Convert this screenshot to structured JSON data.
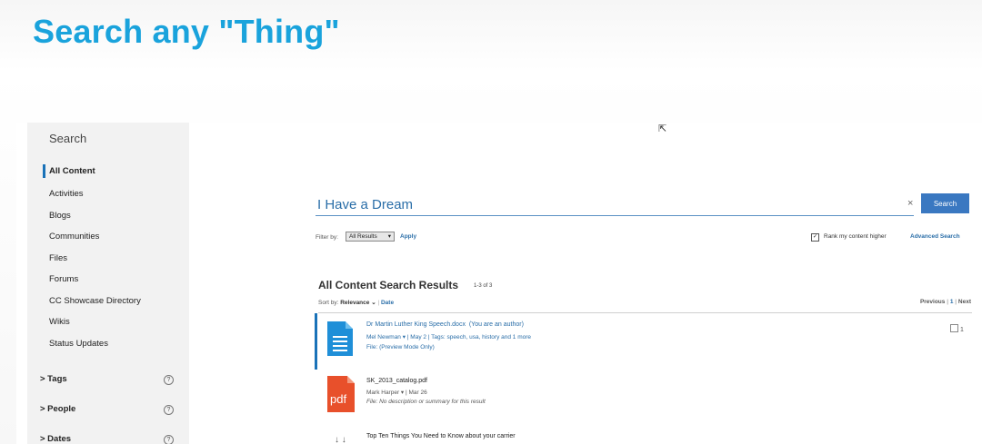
{
  "slide_title": "Search any \"Thing\"",
  "sidebar": {
    "title": "Search",
    "items": [
      {
        "label": "All Content",
        "active": true
      },
      {
        "label": "Activities"
      },
      {
        "label": "Blogs"
      },
      {
        "label": "Communities"
      },
      {
        "label": "Files"
      },
      {
        "label": "Forums"
      },
      {
        "label": "CC Showcase Directory"
      },
      {
        "label": "Wikis"
      },
      {
        "label": "Status Updates"
      }
    ],
    "sections": [
      {
        "label": "> Tags",
        "help": "?"
      },
      {
        "label": "> People",
        "help": "?"
      },
      {
        "label": "> Dates",
        "help": "?"
      }
    ]
  },
  "search": {
    "query": "I Have a Dream",
    "clear": "×",
    "button": "Search"
  },
  "filter": {
    "label": "Filter by:",
    "selected": "All Results",
    "apply": "Apply",
    "rank_label": "Rank my content higher",
    "rank_checked": true,
    "advanced": "Advanced Search"
  },
  "results": {
    "title": "All Content Search Results",
    "count": "1-3 of 3",
    "sort_label": "Sort by:",
    "sort_relevance": "Relevance",
    "sort_date": "Date",
    "pager": {
      "previous": "Previous",
      "current": "1",
      "next": "Next"
    },
    "items": [
      {
        "title": "Dr Martin Luther King Speech.docx",
        "note": "(You are an author)",
        "meta": "Mel Newman  ▾  |  May 2  |  Tags:  speech,  usa,  history  and 1 more",
        "desc": "File:  (Preview Mode Only)",
        "comments": "1",
        "icon": "docx-file-icon"
      },
      {
        "title": "SK_2013_catalog.pdf",
        "meta": "Mark Harper  ▾  |  Mar 26",
        "desc": "File:  No description or summary for this result",
        "icon_text": "pdf",
        "icon": "pdf-file-icon"
      },
      {
        "title": "Top Ten Things You Need to Know about your carrier",
        "icon": "download-icon"
      }
    ]
  },
  "colors": {
    "accent": "#1aa3dc",
    "link": "#2a6ea8",
    "button": "#3a78c1",
    "pdf": "#e8502b",
    "doc": "#1f8fd8"
  }
}
